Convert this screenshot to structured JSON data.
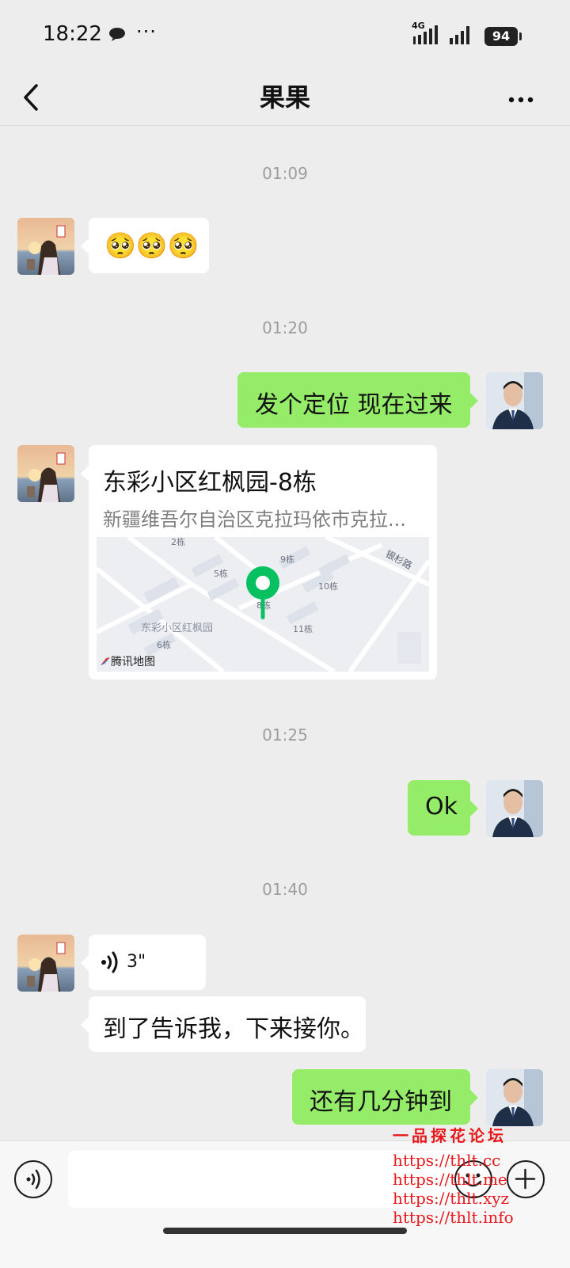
{
  "status_bar": {
    "time": "18:22",
    "extra_icons": "···",
    "network_label": "4G",
    "battery": "94"
  },
  "nav": {
    "title": "果果"
  },
  "timestamps": [
    "01:09",
    "01:20",
    "01:25",
    "01:40"
  ],
  "messages": {
    "m1": {
      "sender": "contact",
      "emoji": [
        "🥺",
        "🥺",
        "🥺"
      ]
    },
    "m2": {
      "sender": "me",
      "text": "发个定位 现在过来"
    },
    "m3": {
      "sender": "contact",
      "location_title": "东彩小区红枫园-8栋",
      "location_address": "新疆维吾尔自治区克拉玛依市克拉...",
      "map": {
        "brand": "腾讯地图",
        "labels": [
          "2栋",
          "5栋",
          "9栋",
          "10栋",
          "8栋",
          "11栋",
          "东彩小区红枫园",
          "6栋",
          "银杉路"
        ]
      }
    },
    "m4": {
      "sender": "me",
      "text": "Ok"
    },
    "m5": {
      "sender": "contact",
      "voice_duration": "3\""
    },
    "m6": {
      "sender": "contact",
      "text": "到了告诉我，下来接你。"
    },
    "m7": {
      "sender": "me",
      "text": "还有几分钟到"
    }
  },
  "input": {
    "value": "",
    "placeholder": ""
  },
  "icons": {
    "back": "back-chevron-icon",
    "more": "more-dots-icon",
    "voice": "voice-input-icon",
    "emoji": "emoji-icon",
    "plus": "plus-icon",
    "map_pin": "map-pin-icon"
  },
  "colors": {
    "background": "#ededed",
    "my_bubble": "#95ec69",
    "their_bubble": "#ffffff",
    "map_pin": "#07c160",
    "watermark": "#e8181c"
  },
  "watermark": {
    "title": "一品探花论坛",
    "lines": [
      "https://thlt.cc",
      "https://thlt.me",
      "https://thlt.xyz",
      "https://thlt.info"
    ]
  }
}
